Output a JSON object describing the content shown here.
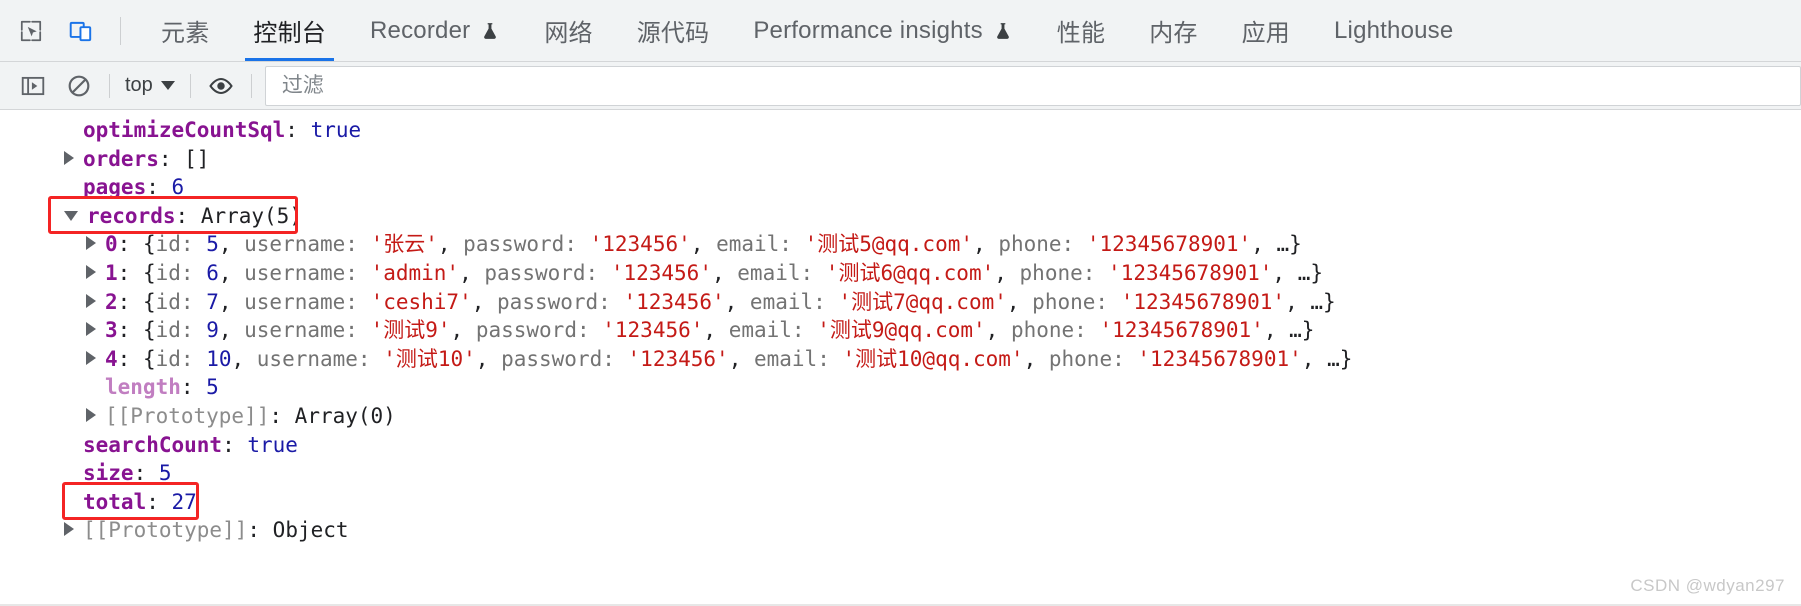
{
  "window": {
    "app": "Chrome DevTools",
    "watermark": "CSDN @wdyan297"
  },
  "topbar": {
    "icons": [
      {
        "name": "inspect-element-icon",
        "label": "Inspect element"
      },
      {
        "name": "device-toolbar-icon",
        "label": "Toggle device toolbar"
      }
    ],
    "tabs": [
      {
        "label": "元素",
        "active": false,
        "experiment": false
      },
      {
        "label": "控制台",
        "active": true,
        "experiment": false
      },
      {
        "label": "Recorder",
        "active": false,
        "experiment": true
      },
      {
        "label": "网络",
        "active": false,
        "experiment": false
      },
      {
        "label": "源代码",
        "active": false,
        "experiment": false
      },
      {
        "label": "Performance insights",
        "active": false,
        "experiment": true
      },
      {
        "label": "性能",
        "active": false,
        "experiment": false
      },
      {
        "label": "内存",
        "active": false,
        "experiment": false
      },
      {
        "label": "应用",
        "active": false,
        "experiment": false
      },
      {
        "label": "Lighthouse",
        "active": false,
        "experiment": false
      }
    ]
  },
  "console_toolbar": {
    "sidebar_toggle": "console-sidebar-icon",
    "clear_console": "clear-console-icon",
    "context": "top",
    "eye": "live-expression-icon",
    "filter_placeholder": "过滤",
    "filter_value": ""
  },
  "colors": {
    "accent": "#1a73e8",
    "property": "#881391",
    "subproperty": "#c17ec1",
    "number": "#1a1aa6",
    "string": "#c41a16",
    "internal": "#8c8c8c",
    "annotation": "#f42424",
    "toolbar_bg": "#f1f3f4",
    "body_bg": "#ffffff"
  },
  "console": {
    "lines": [
      {
        "id": "optimizeCountSql",
        "indent": 1,
        "toggle": "none",
        "key": "optimizeCountSql",
        "key_style": "prop",
        "value": "true",
        "value_style": "bool"
      },
      {
        "id": "orders",
        "indent": 1,
        "toggle": "closed",
        "key": "orders",
        "key_style": "prop",
        "value": "[]",
        "value_style": "obj"
      },
      {
        "id": "pages",
        "indent": 1,
        "toggle": "none",
        "key": "pages",
        "key_style": "prop",
        "value": "6",
        "value_style": "num"
      },
      {
        "id": "records",
        "indent": 1,
        "toggle": "open",
        "key": "records",
        "key_style": "prop",
        "value": "Array(5)",
        "value_style": "obj",
        "highlight": true
      },
      {
        "id": "record-0",
        "indent": 2,
        "toggle": "closed",
        "key": "0",
        "key_style": "idx",
        "record": {
          "id": "5",
          "username": "张云",
          "password": "123456",
          "email": "测试5@qq.com",
          "phone": "12345678901"
        }
      },
      {
        "id": "record-1",
        "indent": 2,
        "toggle": "closed",
        "key": "1",
        "key_style": "idx",
        "record": {
          "id": "6",
          "username": "admin",
          "password": "123456",
          "email": "测试6@qq.com",
          "phone": "12345678901"
        }
      },
      {
        "id": "record-2",
        "indent": 2,
        "toggle": "closed",
        "key": "2",
        "key_style": "idx",
        "record": {
          "id": "7",
          "username": "ceshi7",
          "password": "123456",
          "email": "测试7@qq.com",
          "phone": "12345678901"
        }
      },
      {
        "id": "record-3",
        "indent": 2,
        "toggle": "closed",
        "key": "3",
        "key_style": "idx",
        "record": {
          "id": "9",
          "username": "测试9",
          "password": "123456",
          "email": "测试9@qq.com",
          "phone": "12345678901"
        }
      },
      {
        "id": "record-4",
        "indent": 2,
        "toggle": "closed",
        "key": "4",
        "key_style": "idx",
        "record": {
          "id": "10",
          "username": "测试10",
          "password": "123456",
          "email": "测试10@qq.com",
          "phone": "12345678901"
        }
      },
      {
        "id": "records-length",
        "indent": 2,
        "toggle": "none",
        "key": "length",
        "key_style": "sub",
        "value": "5",
        "value_style": "num"
      },
      {
        "id": "records-prototype",
        "indent": 2,
        "toggle": "closed",
        "key": "[[Prototype]]",
        "key_style": "intern",
        "value": "Array(0)",
        "value_style": "obj"
      },
      {
        "id": "searchCount",
        "indent": 1,
        "toggle": "none",
        "key": "searchCount",
        "key_style": "prop",
        "value": "true",
        "value_style": "bool"
      },
      {
        "id": "size",
        "indent": 1,
        "toggle": "none",
        "key": "size",
        "key_style": "prop",
        "value": "5",
        "value_style": "num"
      },
      {
        "id": "total",
        "indent": 1,
        "toggle": "none",
        "key": "total",
        "key_style": "prop",
        "value": "27",
        "value_style": "num",
        "highlight": true
      },
      {
        "id": "root-prototype",
        "indent": 1,
        "toggle": "closed",
        "key": "[[Prototype]]",
        "key_style": "intern",
        "value": "Object",
        "value_style": "obj"
      }
    ],
    "record_field_labels": [
      "id",
      "username",
      "password",
      "email",
      "phone"
    ],
    "record_open_brace": "{",
    "record_ellipsis": "…}",
    "annotations": [
      {
        "name": "records-highlight-box",
        "target": "records"
      },
      {
        "name": "total-highlight-box",
        "target": "total"
      }
    ]
  }
}
